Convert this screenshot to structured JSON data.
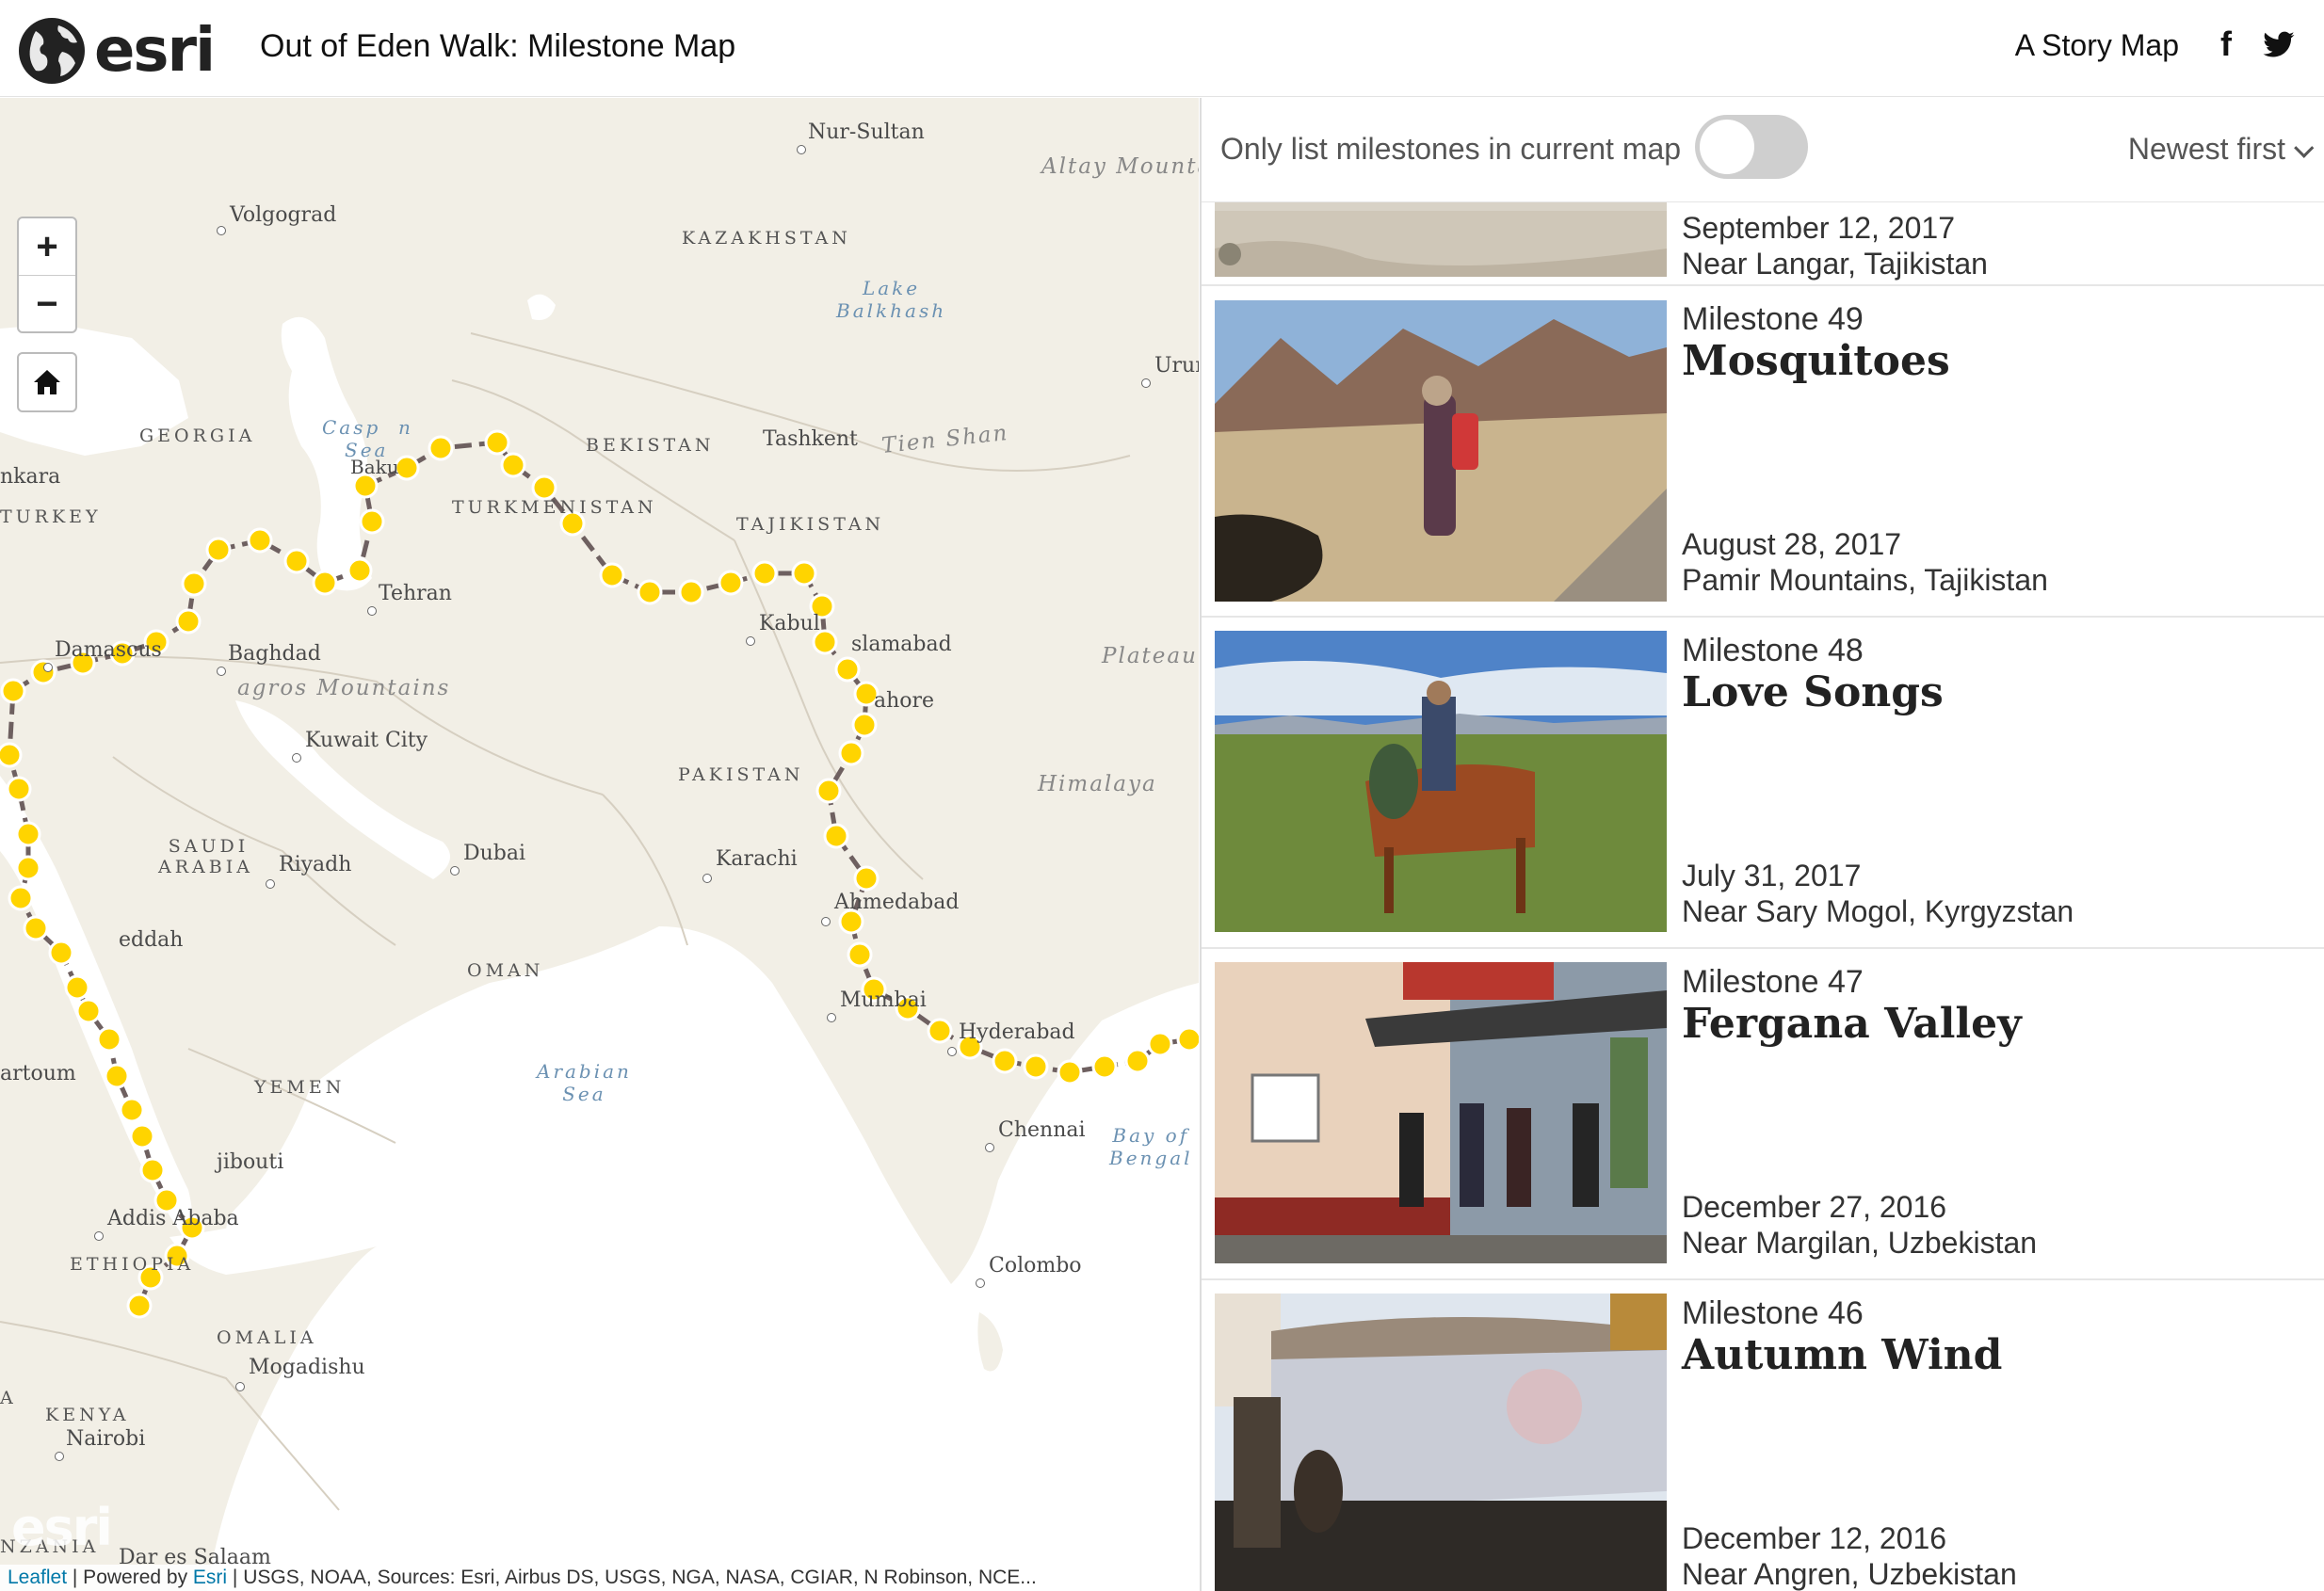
{
  "header": {
    "logo_text": "esri",
    "title": "Out of Eden Walk: Milestone Map",
    "story_map_label": "A Story Map",
    "facebook_icon": "f"
  },
  "map": {
    "zoom_in": "+",
    "zoom_out": "−",
    "watermark": "esri",
    "attribution": {
      "leaflet": "Leaflet",
      "powered_by": " | Powered by ",
      "esri": "Esri",
      "sources": " | USGS, NOAA, Sources: Esri, Airbus DS, USGS, NGA, NASA, CGIAR, N Robinson, NCE..."
    },
    "labels": {
      "nur_sultan": "Nur-Sultan",
      "volgograd": "Volgograd",
      "kazakhstan": "KAZAKHSTAN",
      "altay": "Altay Mounta",
      "lake_balkhash_1": "Lake",
      "lake_balkhash_2": "Balkhash",
      "urum": "Urur",
      "ankara": "nkara",
      "georgia": "GEORGIA",
      "caspian_1": "Casp",
      "caspian_1b": "n",
      "caspian_2": "Sea",
      "baku": "Baku",
      "uzbekistan": "BEKISTAN",
      "tashkent": "Tashkent",
      "tien_shan": "Tien Shan",
      "turkey": "TURKEY",
      "turkmenistan": "TURKMENISTAN",
      "tajikistan": "TAJIKISTAN",
      "tehran": "Tehran",
      "kabul": "Kabul",
      "islamabad": "slamabad",
      "plateau": "Plateau",
      "damascus": "Damascus",
      "baghdad": "Baghdad",
      "zagros": "agros Mountains",
      "lahore": "ahore",
      "kuwait": "Kuwait City",
      "pakistan": "PAKISTAN",
      "himalaya": "Himalaya",
      "saudi_1": "SAUDI",
      "saudi_2": "ARABIA",
      "riyadh": "Riyadh",
      "dubai": "Dubai",
      "karachi": "Karachi",
      "ahmedabad": "Ahmedabad",
      "jeddah": "eddah",
      "oman": "OMAN",
      "mumbai": "Mumbai",
      "hyderabad": "Hyderabad",
      "khartoum": "artoum",
      "yemen": "YEMEN",
      "arabian_1": "Arabian",
      "arabian_2": "Sea",
      "chennai": "Chennai",
      "bay_1": "Bay of",
      "bay_2": "Bengal",
      "djibouti": "jibouti",
      "addis": "Addis Ababa",
      "ethiopia": "ETHIOPIA",
      "colombo": "Colombo",
      "somalia": "OMALIA",
      "mogadishu": "Mogadishu",
      "kenya": "KENYA",
      "nairobi": "Nairobi",
      "dar": "Dar es Salaam",
      "tanzania": "NZANIA",
      "edge_a": "A"
    }
  },
  "sidebar": {
    "filter_label": "Only list milestones in current map",
    "toggle_state": "off",
    "sort_label": "Newest first",
    "items": [
      {
        "number": "",
        "title": "",
        "date": "September 12, 2017",
        "location": "Near Langar, Tajikistan"
      },
      {
        "number": "Milestone 49",
        "title": "Mosquitoes",
        "date": "August 28, 2017",
        "location": "Pamir Mountains, Tajikistan"
      },
      {
        "number": "Milestone 48",
        "title": "Love Songs",
        "date": "July 31, 2017",
        "location": "Near Sary Mogol, Kyrgyzstan"
      },
      {
        "number": "Milestone 47",
        "title": "Fergana Valley",
        "date": "December 27, 2016",
        "location": "Near Margilan, Uzbekistan"
      },
      {
        "number": "Milestone 46",
        "title": "Autumn Wind",
        "date": "December 12, 2016",
        "location": "Near Angren, Uzbekistan"
      }
    ]
  },
  "colors": {
    "land": "#f2efe6",
    "water": "#ffffff",
    "route_marker": "#ffd400",
    "route_line": "#6e6060"
  }
}
